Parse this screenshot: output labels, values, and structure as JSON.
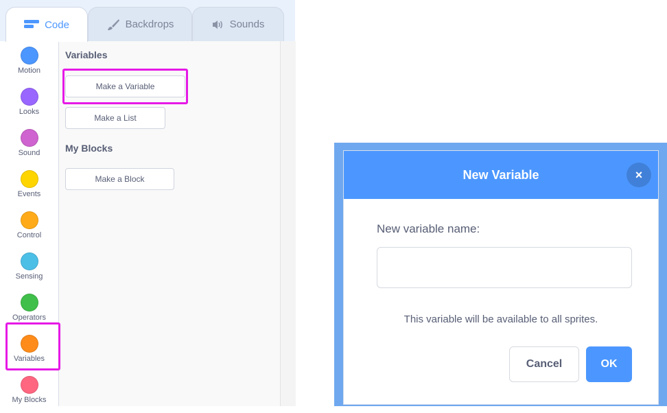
{
  "tabs": [
    {
      "label": "Code",
      "icon": "code-icon",
      "active": true
    },
    {
      "label": "Backdrops",
      "icon": "paintbrush-icon",
      "active": false
    },
    {
      "label": "Sounds",
      "icon": "speaker-icon",
      "active": false
    }
  ],
  "categories": [
    {
      "label": "Motion",
      "color": "#4c97ff"
    },
    {
      "label": "Looks",
      "color": "#9966ff"
    },
    {
      "label": "Sound",
      "color": "#cf63cf"
    },
    {
      "label": "Events",
      "color": "#ffd500"
    },
    {
      "label": "Control",
      "color": "#ffab19"
    },
    {
      "label": "Sensing",
      "color": "#4cbfe6"
    },
    {
      "label": "Operators",
      "color": "#40bf4a"
    },
    {
      "label": "Variables",
      "color": "#ff8c1a",
      "selected": true
    },
    {
      "label": "My Blocks",
      "color": "#ff6680"
    }
  ],
  "palette": {
    "variables_title": "Variables",
    "make_variable": "Make a Variable",
    "make_list": "Make a List",
    "myblocks_title": "My Blocks",
    "make_block": "Make a Block"
  },
  "dialog": {
    "title": "New Variable",
    "close": "×",
    "field_label": "New variable name:",
    "input_value": "",
    "hint": "This variable will be available to all sprites.",
    "cancel": "Cancel",
    "ok": "OK"
  },
  "colors": {
    "accent": "#4c97ff",
    "highlight": "#e619e6"
  }
}
